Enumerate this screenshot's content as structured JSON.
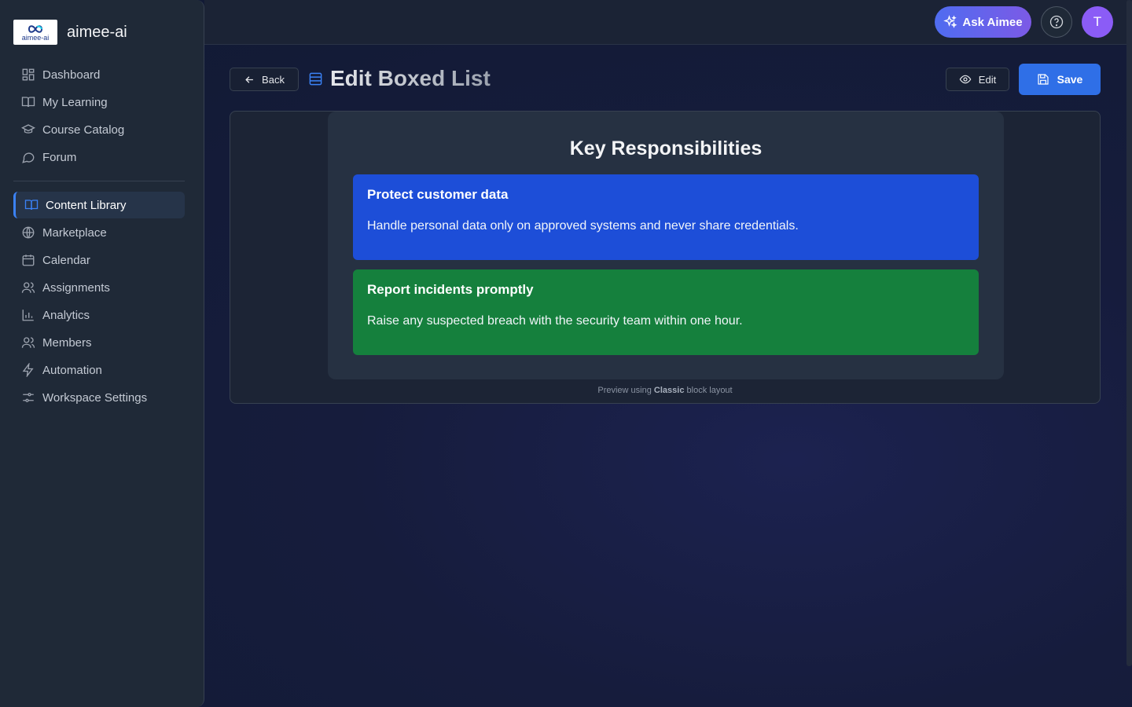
{
  "brand": {
    "name": "aimee-ai",
    "logo_text": "aimee-ai"
  },
  "sidebar": {
    "primary": [
      {
        "label": "Dashboard",
        "icon": "dashboard-icon"
      },
      {
        "label": "My Learning",
        "icon": "book-open-icon"
      },
      {
        "label": "Course Catalog",
        "icon": "graduation-cap-icon"
      },
      {
        "label": "Forum",
        "icon": "chat-bubble-icon"
      }
    ],
    "secondary": [
      {
        "label": "Content Library",
        "icon": "book-open-icon",
        "active": true
      },
      {
        "label": "Marketplace",
        "icon": "globe-icon"
      },
      {
        "label": "Calendar",
        "icon": "calendar-icon"
      },
      {
        "label": "Assignments",
        "icon": "users-icon"
      },
      {
        "label": "Analytics",
        "icon": "bar-chart-icon"
      },
      {
        "label": "Members",
        "icon": "users-icon"
      },
      {
        "label": "Automation",
        "icon": "lightning-icon"
      },
      {
        "label": "Workspace Settings",
        "icon": "sliders-icon"
      }
    ]
  },
  "topbar": {
    "ask_label": "Ask Aimee",
    "avatar_initial": "T"
  },
  "header": {
    "back_label": "Back",
    "title": "Edit Boxed List",
    "edit_label": "Edit",
    "save_label": "Save"
  },
  "preview": {
    "heading": "Key Responsibilities",
    "items": [
      {
        "title": "Protect customer data",
        "body": "Handle personal data only on approved systems and never share credentials.",
        "color": "#1d4ed8"
      },
      {
        "title": "Report incidents promptly",
        "body": "Raise any suspected breach with the security team within one hour.",
        "color": "#15803d"
      }
    ],
    "note_prefix": "Preview using",
    "note_layout": "Classic",
    "note_suffix": "block layout"
  },
  "colors": {
    "accent": "#3b82f6",
    "save": "#2f6fe7",
    "avatar": "#8b5cf6"
  }
}
